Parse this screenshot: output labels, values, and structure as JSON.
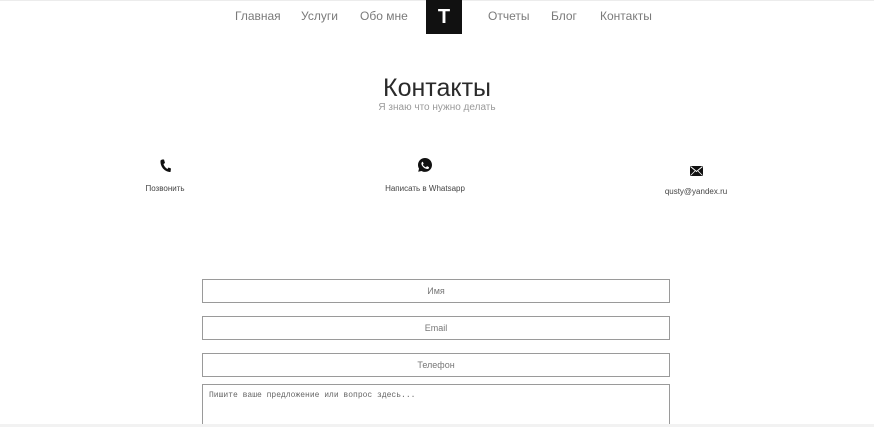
{
  "nav": {
    "items": [
      {
        "label": "Главная"
      },
      {
        "label": "Услуги"
      },
      {
        "label": "Обо мне"
      },
      {
        "label": "Отчеты"
      },
      {
        "label": "Блог"
      },
      {
        "label": "Контакты"
      }
    ],
    "logo": "Т"
  },
  "header": {
    "title": "Контакты",
    "subtitle": "Я знаю что нужно делать"
  },
  "contacts": [
    {
      "icon": "phone-icon",
      "label": "Позвонить"
    },
    {
      "icon": "whatsapp-icon",
      "label": "Написать в Whatsapp"
    },
    {
      "icon": "mail-icon",
      "label": "qusty@yandex.ru"
    }
  ],
  "form": {
    "name_placeholder": "Имя",
    "email_placeholder": "Email",
    "phone_placeholder": "Телефон",
    "message_placeholder": "Пишите ваше предложение или вопрос здесь..."
  },
  "colors": {
    "logo_bg": "#111111",
    "text": "#333333",
    "muted": "#9a9a9a",
    "border": "#9a9a9a"
  }
}
